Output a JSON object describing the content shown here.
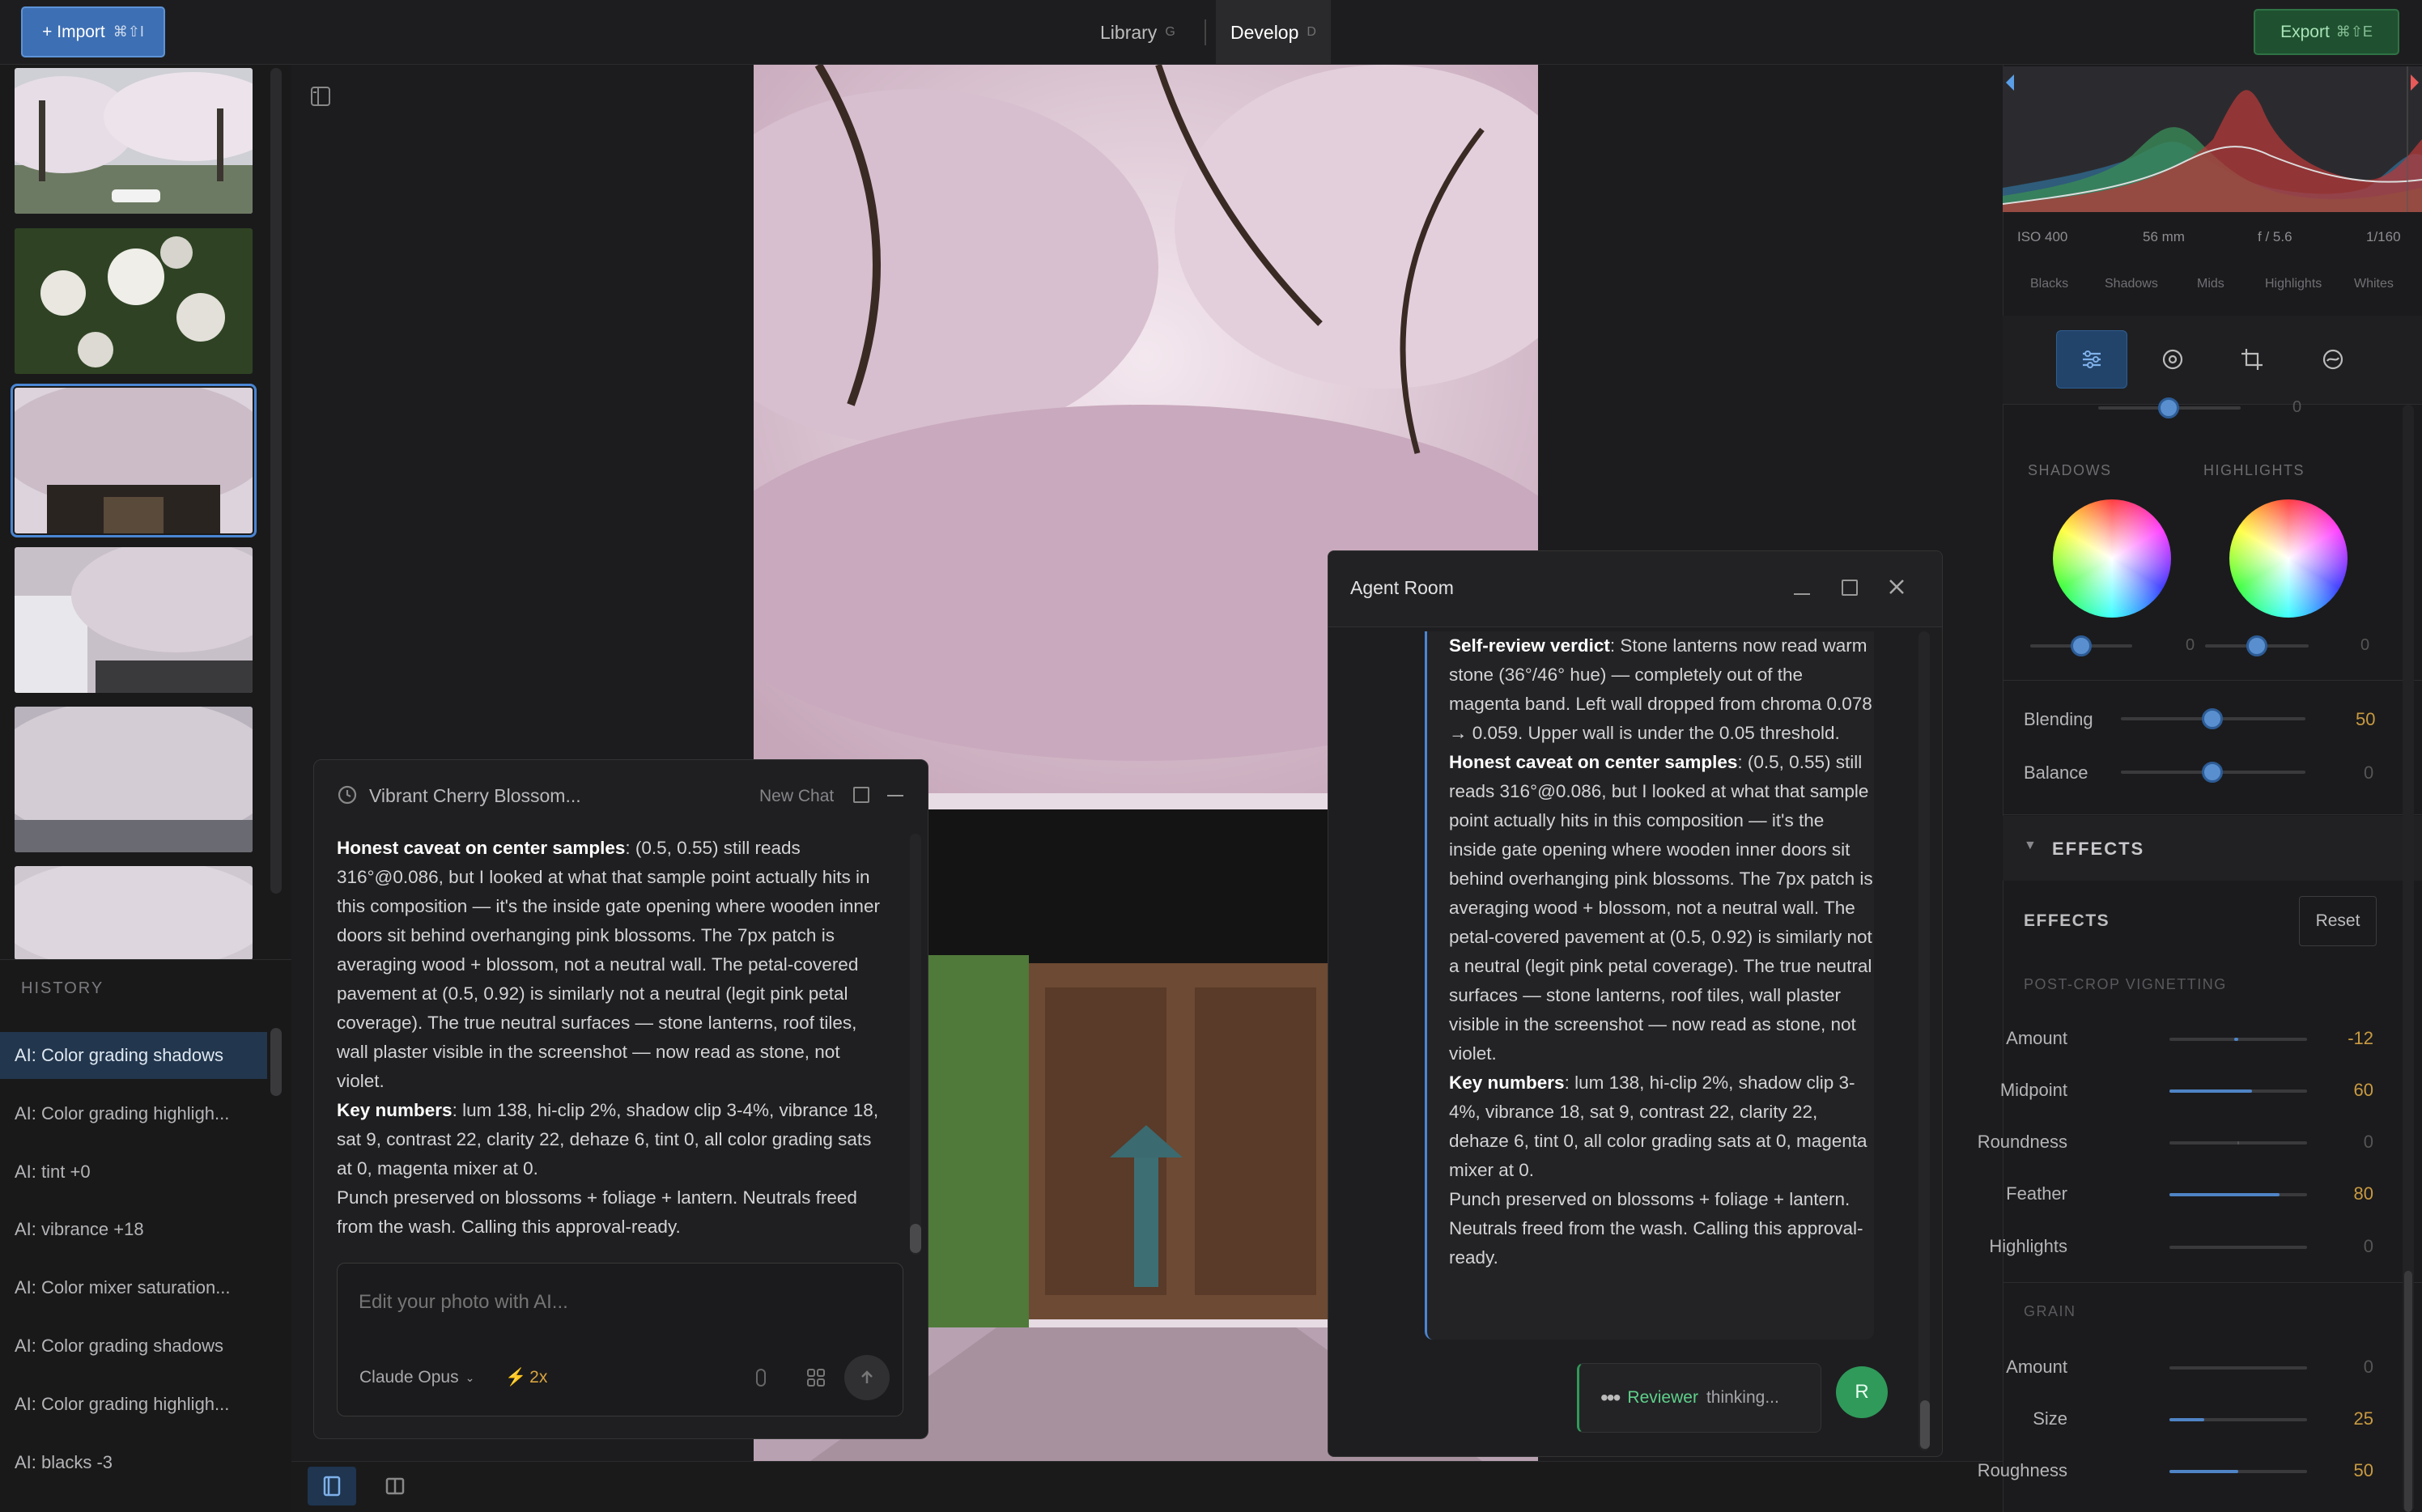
{
  "topbar": {
    "import_label": "+ Import",
    "import_shortcut": "⌘⇧I",
    "tabs": [
      {
        "label": "Library",
        "shortcut": "G"
      },
      {
        "label": "Develop",
        "shortcut": "D"
      }
    ],
    "export_label": "Export",
    "export_shortcut": "⌘⇧E"
  },
  "history": {
    "title": "HISTORY",
    "items": [
      "AI: Color grading shadows",
      "AI: Color grading highligh...",
      "AI: tint +0",
      "AI: vibrance +18",
      "AI: Color mixer saturation...",
      "AI: Color grading shadows",
      "AI: Color grading highligh...",
      "AI: blacks -3"
    ]
  },
  "chat": {
    "title": "Vibrant Cherry Blossom...",
    "new_chat": "New Chat",
    "p1_bold": "Honest caveat on center samples",
    "p1": ": (0.5, 0.55) still reads 316°@0.086, but I looked at what that sample point actually hits in this composition — it's the inside gate opening where wooden inner doors sit behind overhanging pink blossoms. The 7px patch is averaging wood + blossom, not a neutral wall. The petal-covered pavement at (0.5, 0.92) is similarly not a neutral (legit pink petal coverage). The true neutral surfaces — stone lanterns, roof tiles, wall plaster visible in the screenshot — now read as stone, not violet.",
    "p2_bold": "Key numbers",
    "p2": ": lum 138, hi-clip 2%, shadow clip 3-4%, vibrance 18, sat 9, contrast 22, clarity 22, dehaze 6, tint 0, all color grading sats at 0, magenta mixer at 0.",
    "p3": "Punch preserved on blossoms + foliage + lantern. Neutrals freed from the wash. Calling this approval-ready.",
    "input_placeholder": "Edit your photo with AI...",
    "model": "Claude Opus",
    "speed": "2x"
  },
  "agent_room": {
    "title": "Agent Room",
    "p0_bold": "Self-review verdict",
    "p0": ": Stone lanterns now read warm stone (36°/46° hue) — completely out of the magenta band. Left wall dropped from chroma 0.078 → 0.059. Upper wall is under the 0.05 threshold.",
    "p1_bold": "Honest caveat on center samples",
    "p1": ": (0.5, 0.55) still reads 316°@0.086, but I looked at what that sample point actually hits in this composition — it's the inside gate opening where wooden inner doors sit behind overhanging pink blossoms. The 7px patch is averaging wood + blossom, not a neutral wall. The petal-covered pavement at (0.5, 0.92) is similarly not a neutral (legit pink petal coverage). The true neutral surfaces — stone lanterns, roof tiles, wall plaster visible in the screenshot — now read as stone, not violet.",
    "p2_bold": "Key numbers",
    "p2": ": lum 138, hi-clip 2%, shadow clip 3-4%, vibrance 18, sat 9, contrast 22, clarity 22, dehaze 6, tint 0, all color grading sats at 0, magenta mixer at 0.",
    "p3": "Punch preserved on blossoms + foliage + lantern. Neutrals freed from the wash. Calling this approval-ready.",
    "status_name": "Reviewer",
    "status_text": "thinking...",
    "avatar_letter": "R"
  },
  "exif": {
    "iso": "ISO 400",
    "focal": "56 mm",
    "aperture": "f / 5.6",
    "shutter": "1/160"
  },
  "zones": [
    "Blacks",
    "Shadows",
    "Mids",
    "Highlights",
    "Whites"
  ],
  "grading": {
    "top_value": "0",
    "shadows_label": "SHADOWS",
    "highlights_label": "HIGHLIGHTS",
    "shadows_value": "0",
    "highlights_value": "0",
    "blending_label": "Blending",
    "blending_value": "50",
    "balance_label": "Balance",
    "balance_value": "0"
  },
  "effects": {
    "section_title": "EFFECTS",
    "subtitle": "EFFECTS",
    "reset_label": "Reset",
    "vignette_title": "POST-CROP VIGNETTING",
    "vignette": [
      {
        "label": "Amount",
        "value": "-12",
        "level": 0.47
      },
      {
        "label": "Midpoint",
        "value": "60",
        "level": 0.6
      },
      {
        "label": "Roundness",
        "value": "0",
        "level": 0.5
      },
      {
        "label": "Feather",
        "value": "80",
        "level": 0.8
      },
      {
        "label": "Highlights",
        "value": "0",
        "level": 0
      }
    ],
    "grain_title": "GRAIN",
    "grain": [
      {
        "label": "Amount",
        "value": "0",
        "level": 0
      },
      {
        "label": "Size",
        "value": "25",
        "level": 0.25
      },
      {
        "label": "Roughness",
        "value": "50",
        "level": 0.5
      }
    ]
  },
  "colors": {
    "accent": "#4a86d4",
    "export_green": "#1f5130",
    "value_gold": "#c99a40",
    "reviewer_green": "#2f9a5a"
  }
}
